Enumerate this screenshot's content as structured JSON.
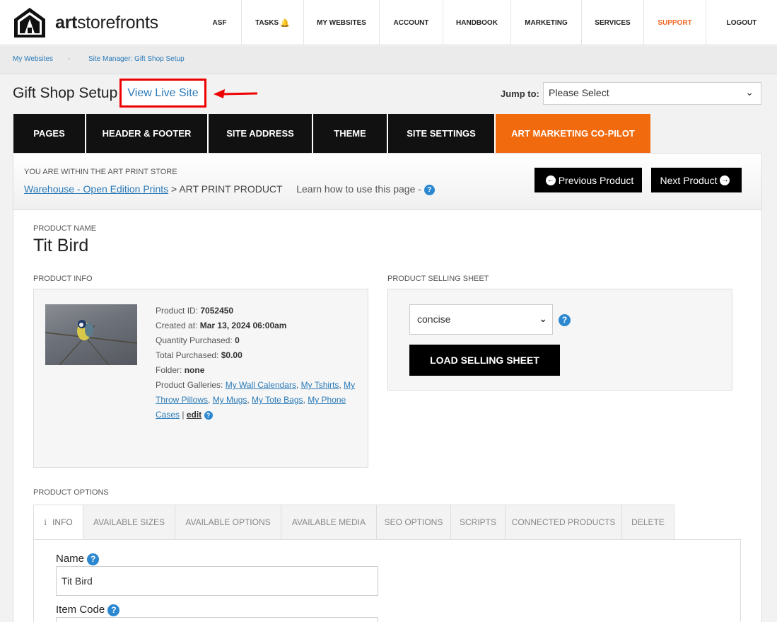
{
  "logo": {
    "brand_bold": "art",
    "brand_rest": "storefronts"
  },
  "nav": {
    "items": [
      {
        "label": "ASF"
      },
      {
        "label": "TASKS"
      },
      {
        "label": "MY WEBSITES"
      },
      {
        "label": "ACCOUNT"
      },
      {
        "label": "HANDBOOK"
      },
      {
        "label": "MARKETING"
      },
      {
        "label": "SERVICES"
      },
      {
        "label": "SUPPORT"
      },
      {
        "label": "LOGOUT"
      }
    ],
    "tasks_icon": "bell-icon",
    "support_color": "#f26722"
  },
  "breadcrumb": {
    "items": [
      "My Websites",
      "Site Manager: Gift Shop Setup"
    ],
    "separator": "-"
  },
  "header": {
    "title": "Gift Shop Setup",
    "view_live": "View Live Site",
    "jump_label": "Jump to:",
    "jump_value": "Please Select"
  },
  "main_tabs": [
    {
      "label": "PAGES"
    },
    {
      "label": "HEADER & FOOTER"
    },
    {
      "label": "SITE ADDRESS"
    },
    {
      "label": "THEME"
    },
    {
      "label": "SITE SETTINGS"
    },
    {
      "label": "ART MARKETING CO-PILOT"
    }
  ],
  "accent_color": "#f26a0e",
  "store": {
    "within": "YOU ARE WITHIN THE ART PRINT STORE",
    "warehouse_link": "Warehouse - Open Edition Prints",
    "crumb_sep": ">",
    "current": "ART PRINT PRODUCT",
    "learn": "Learn how to use this page -",
    "prev_button": "Previous Product",
    "next_button": "Next Product"
  },
  "product": {
    "name_label": "PRODUCT NAME",
    "name": "Tit Bird",
    "info_label": "PRODUCT INFO",
    "id_label": "Product ID:",
    "id": "7052450",
    "created_label": "Created at:",
    "created": "Mar 13, 2024 06:00am",
    "qty_label": "Quantity Purchased:",
    "qty": "0",
    "total_label": "Total Purchased:",
    "total": "$0.00",
    "folder_label": "Folder:",
    "folder": "none",
    "galleries_label": "Product Galleries:",
    "galleries": [
      "My Wall Calendars",
      "My Tshirts",
      "My Throw Pillows",
      "My Mugs",
      "My Tote Bags",
      "My Phone Cases"
    ],
    "edit": "edit"
  },
  "selling": {
    "label": "PRODUCT SELLING SHEET",
    "value": "concise",
    "button": "LOAD SELLING SHEET"
  },
  "options": {
    "label": "PRODUCT OPTIONS",
    "tabs": [
      {
        "label": "INFO"
      },
      {
        "label": "AVAILABLE SIZES"
      },
      {
        "label": "AVAILABLE OPTIONS"
      },
      {
        "label": "AVAILABLE MEDIA"
      },
      {
        "label": "SEO OPTIONS"
      },
      {
        "label": "SCRIPTS"
      },
      {
        "label": "CONNECTED PRODUCTS"
      },
      {
        "label": "DELETE"
      }
    ],
    "name_label": "Name",
    "name_value": "Tit Bird",
    "itemcode_label": "Item Code",
    "itemcode_value": ""
  }
}
